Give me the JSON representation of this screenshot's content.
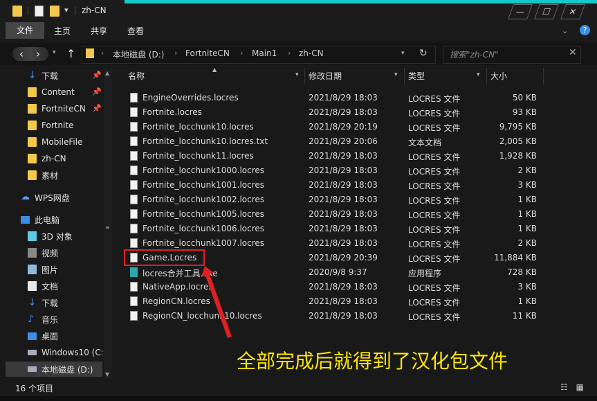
{
  "window": {
    "title": "zh-CN",
    "accent_color": "#15c8c8",
    "minimize_label": "—",
    "maximize_label": "☐",
    "close_label": "✕"
  },
  "ribbon": {
    "tabs": [
      "文件",
      "主页",
      "共享",
      "查看"
    ],
    "help_label": "?"
  },
  "address": {
    "crumbs": [
      "本地磁盘 (D:)",
      "FortniteCN",
      "Main1",
      "zh-CN"
    ],
    "search_placeholder": "搜索\"zh-CN\""
  },
  "nav": {
    "quick_access": [
      {
        "label": "下载",
        "icon": "download-icon",
        "pinned": true
      },
      {
        "label": "Content",
        "icon": "folder-icon",
        "pinned": true
      },
      {
        "label": "FortniteCN",
        "icon": "folder-icon",
        "pinned": true
      },
      {
        "label": "Fortnite",
        "icon": "folder-icon",
        "pinned": false
      },
      {
        "label": "MobileFile",
        "icon": "folder-icon",
        "pinned": false
      },
      {
        "label": "zh-CN",
        "icon": "folder-icon",
        "pinned": false
      },
      {
        "label": "素材",
        "icon": "folder-icon",
        "pinned": false
      }
    ],
    "cloud": {
      "label": "WPS网盘",
      "icon": "cloud-icon"
    },
    "this_pc": {
      "label": "此电脑",
      "icon": "monitor-icon"
    },
    "pc_items": [
      {
        "label": "3D 对象",
        "icon": "cube-icon"
      },
      {
        "label": "视频",
        "icon": "video-icon"
      },
      {
        "label": "图片",
        "icon": "picture-icon"
      },
      {
        "label": "文档",
        "icon": "document-icon"
      },
      {
        "label": "下载",
        "icon": "download-icon"
      },
      {
        "label": "音乐",
        "icon": "music-icon"
      },
      {
        "label": "桌面",
        "icon": "desktop-icon"
      },
      {
        "label": "Windows10 (C:",
        "icon": "drive-icon"
      },
      {
        "label": "本地磁盘 (D:)",
        "icon": "drive-icon"
      }
    ]
  },
  "columns": {
    "name": "名称",
    "date": "修改日期",
    "type": "类型",
    "size": "大小"
  },
  "files": [
    {
      "name": "EngineOverrides.locres",
      "date": "2021/8/29 18:03",
      "type": "LOCRES 文件",
      "size": "50 KB",
      "icon": "file-icon"
    },
    {
      "name": "Fortnite.locres",
      "date": "2021/8/29 18:03",
      "type": "LOCRES 文件",
      "size": "93 KB",
      "icon": "file-icon"
    },
    {
      "name": "Fortnite_locchunk10.locres",
      "date": "2021/8/29 20:19",
      "type": "LOCRES 文件",
      "size": "9,795 KB",
      "icon": "file-icon"
    },
    {
      "name": "Fortnite_locchunk10.locres.txt",
      "date": "2021/8/29 20:06",
      "type": "文本文档",
      "size": "2,005 KB",
      "icon": "text-file-icon"
    },
    {
      "name": "Fortnite_locchunk11.locres",
      "date": "2021/8/29 18:03",
      "type": "LOCRES 文件",
      "size": "1,928 KB",
      "icon": "file-icon"
    },
    {
      "name": "Fortnite_locchunk1000.locres",
      "date": "2021/8/29 18:03",
      "type": "LOCRES 文件",
      "size": "2 KB",
      "icon": "file-icon"
    },
    {
      "name": "Fortnite_locchunk1001.locres",
      "date": "2021/8/29 18:03",
      "type": "LOCRES 文件",
      "size": "3 KB",
      "icon": "file-icon"
    },
    {
      "name": "Fortnite_locchunk1002.locres",
      "date": "2021/8/29 18:03",
      "type": "LOCRES 文件",
      "size": "1 KB",
      "icon": "file-icon"
    },
    {
      "name": "Fortnite_locchunk1005.locres",
      "date": "2021/8/29 18:03",
      "type": "LOCRES 文件",
      "size": "1 KB",
      "icon": "file-icon"
    },
    {
      "name": "Fortnite_locchunk1006.locres",
      "date": "2021/8/29 18:03",
      "type": "LOCRES 文件",
      "size": "1 KB",
      "icon": "file-icon"
    },
    {
      "name": "Fortnite_locchunk1007.locres",
      "date": "2021/8/29 18:03",
      "type": "LOCRES 文件",
      "size": "2 KB",
      "icon": "file-icon"
    },
    {
      "name": "Game.Locres",
      "date": "2021/8/29 20:39",
      "type": "LOCRES 文件",
      "size": "11,884 KB",
      "icon": "file-icon"
    },
    {
      "name": "locres合并工具.exe",
      "date": "2020/9/8 9:37",
      "type": "应用程序",
      "size": "728 KB",
      "icon": "app-icon"
    },
    {
      "name": "NativeApp.locres",
      "date": "2021/8/29 18:03",
      "type": "LOCRES 文件",
      "size": "3 KB",
      "icon": "file-icon"
    },
    {
      "name": "RegionCN.locres",
      "date": "2021/8/29 18:03",
      "type": "LOCRES 文件",
      "size": "1 KB",
      "icon": "file-icon"
    },
    {
      "name": "RegionCN_locchunk10.locres",
      "date": "2021/8/29 18:03",
      "type": "LOCRES 文件",
      "size": "11 KB",
      "icon": "file-icon"
    }
  ],
  "annotation": {
    "caption": "全部完成后就得到了汉化包文件",
    "caption_color": "#ffe600",
    "highlight_color": "#e02020"
  },
  "status": {
    "count": "16 个项目"
  }
}
